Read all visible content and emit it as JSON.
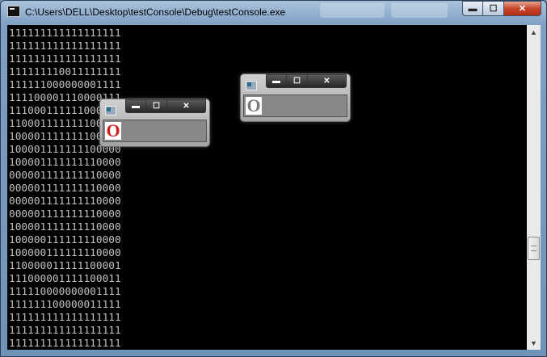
{
  "window": {
    "title": "C:\\Users\\DELL\\Desktop\\testConsole\\Debug\\testConsole.exe",
    "minimize_glyph": "▬",
    "maximize_glyph": "☐",
    "close_glyph": "✕"
  },
  "console": {
    "lines": [
      "111111111111111111",
      "111111111111111111",
      "111111111111111111",
      "111111110011111111",
      "111111000000001111",
      "111100001110000111",
      "111000111111000011",
      "110001111111100001",
      "100001111111100001",
      "100001111111100000",
      "100001111111110000",
      "000001111111110000",
      "000001111111110000",
      "000001111111110000",
      "000001111111110000",
      "100001111111110000",
      "100000111111110000",
      "100000111111110000",
      "110000011111100001",
      "111000001111100011",
      "111110000000001111",
      "111111100000011111",
      "111111111111111111",
      "111111111111111111",
      "111111111111111111"
    ]
  },
  "scrollbar": {
    "up_arrow": "▲",
    "down_arrow": "▼"
  },
  "popup_red": {
    "glyph": "O",
    "glyph_color": "#cc1f1f",
    "min_glyph": "▬",
    "max_glyph": "☐",
    "close_glyph": "✕"
  },
  "popup_gray": {
    "glyph": "O",
    "glyph_color": "#7a7a7a",
    "min_glyph": "▬",
    "max_glyph": "☐",
    "close_glyph": "✕"
  }
}
